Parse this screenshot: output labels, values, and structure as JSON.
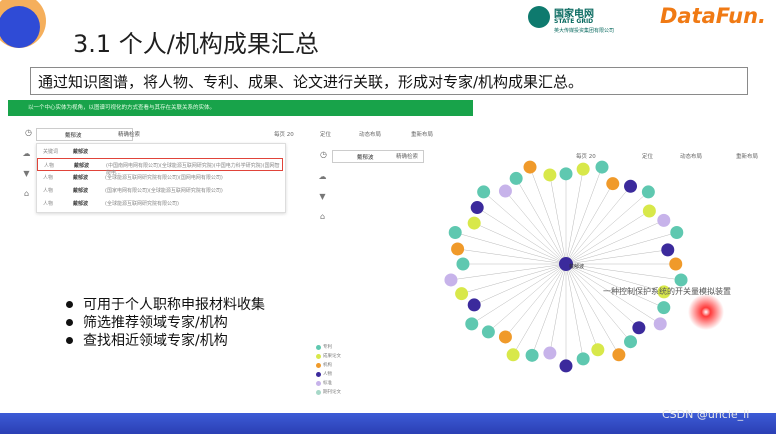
{
  "slide": {
    "title": "3.1 个人/机构成果汇总",
    "banner": "通过知识图谱，将人物、专利、成果、论文进行关联，形成对专家/机构成果汇总。",
    "bullets": [
      "可用于个人职称申报材料收集",
      "筛选推荐领域专家/机构",
      "查找相近领域专家/机构"
    ],
    "watermark": "CSDN @uncle_ll"
  },
  "logos": {
    "state_grid_cn": "国家电网",
    "state_grid_en": "STATE GRID",
    "state_grid_sub": "英大传媒投资集团有限公司",
    "datafun": "DataFun."
  },
  "app": {
    "notice": "以一个中心实体为视角，以图谱可视化的方式查看与其存在关联关系的实体。",
    "search_value": "戴郁波",
    "search_btn": "精确检索",
    "pager": "每页 20",
    "locate": "定位",
    "layout": "动态布局",
    "reset": "重新布局",
    "dropdown": [
      {
        "type": "关键词",
        "name": "戴郁波",
        "org": ""
      },
      {
        "type": "人物",
        "name": "戴郁波",
        "org": "(中国南网电网有限公司)(全球能源互联网研究院)(中国电力科学研究院)(国网智能电..."
      },
      {
        "type": "人物",
        "name": "戴郁波",
        "org": "(全球能源互联网研究院有限公司)(国网电网有限公司)"
      },
      {
        "type": "人物",
        "name": "戴郁波",
        "org": "(国家电网有限公司)(全球能源互联网研究院有限公司)"
      },
      {
        "type": "人物",
        "name": "戴郁波",
        "org": "(全球能源互联网研究院有限公司)"
      }
    ],
    "graph_center": "戴郁波",
    "graph_hover": "一种控制保护系统的开关量模拟装置",
    "legend": [
      {
        "label": "专利",
        "color": "#5fc8b0"
      },
      {
        "label": "成果论文",
        "color": "#d8e84a"
      },
      {
        "label": "机构",
        "color": "#f09a2a"
      },
      {
        "label": "人物",
        "color": "#3b2a9c"
      },
      {
        "label": "标准",
        "color": "#c7b3ea"
      },
      {
        "label": "期刊论文",
        "color": "#a7d8c8"
      }
    ]
  }
}
